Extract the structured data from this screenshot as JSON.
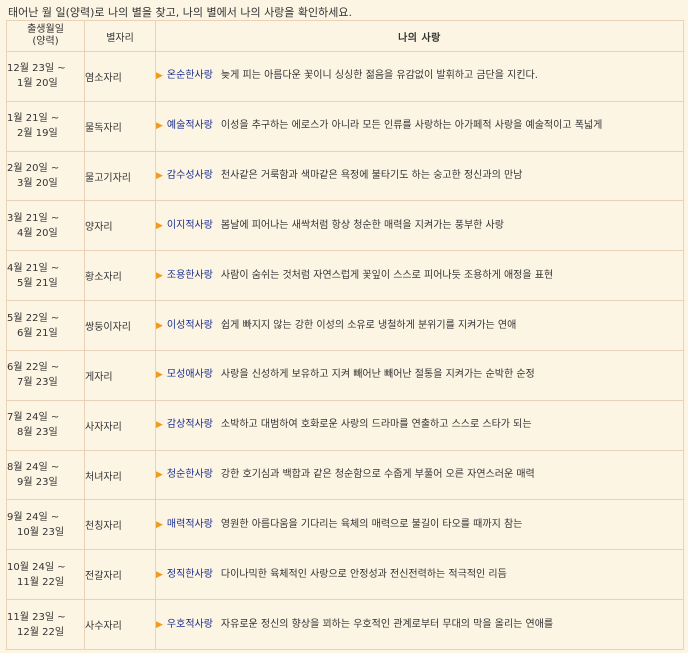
{
  "intro": "태어난 월 일(양력)로 나의 별을 찾고, 나의 별에서 나의 사랑을 확인하세요.",
  "header": {
    "date_line1": "출생월일",
    "date_line2": "(양력)",
    "sign": "별자리",
    "love": "나의 사랑"
  },
  "colors": {
    "accent_arrow": "#f39a1e",
    "love_type": "#1a2e8f",
    "border": "#e8d3b8",
    "background": "#fdf5e4"
  },
  "rows": [
    {
      "d1": "12월 23일 ~",
      "d2": "1월 20일",
      "sign": "염소자리",
      "type": "온순한사랑",
      "desc": "늦게 피는 아름다운 꽃이니 싱싱한 젊음을 유감없이 발휘하고 금단을 지킨다."
    },
    {
      "d1": "1월 21일 ~",
      "d2": "2월 19일",
      "sign": "물독자리",
      "type": "예술적사랑",
      "desc": "이성을 추구하는 에로스가 아니라 모든 인류를 사랑하는 아가페적 사랑을 예술적이고 폭넓게"
    },
    {
      "d1": "2월 20일 ~",
      "d2": "3월 20일",
      "sign": "물고기자리",
      "type": "감수성사랑",
      "desc": "천사같은 거룩함과 색마같은 욕정에 불타기도 하는 숭고한 정신과의 만남"
    },
    {
      "d1": "3월 21일 ~",
      "d2": "4월 20일",
      "sign": "양자리",
      "type": "이지적사랑",
      "desc": "봄날에 피어나는 새싹처럼 항상 청순한 매력을 지켜가는 풍부한 사랑"
    },
    {
      "d1": "4월 21일 ~",
      "d2": "5월 21일",
      "sign": "황소자리",
      "type": "조용한사랑",
      "desc": "사람이 숨쉬는 것처럼 자연스럽게 꽃잎이 스스로 피어나듯 조용하게 애정을 표현"
    },
    {
      "d1": "5월 22일 ~",
      "d2": "6월 21일",
      "sign": "쌍둥이자리",
      "type": "이성적사랑",
      "desc": "쉽게 빠지지 않는 강한 이성의 소유로 냉철하게 분위기를 지켜가는 연애"
    },
    {
      "d1": "6월 22일 ~",
      "d2": "7월 23일",
      "sign": "게자리",
      "type": "모성애사랑",
      "desc": "사랑을 신성하게 보유하고 지켜 빼어난 빼어난 절통을 지켜가는 순박한 순정"
    },
    {
      "d1": "7월 24일 ~",
      "d2": "8월 23일",
      "sign": "사자자리",
      "type": "감상적사랑",
      "desc": "소박하고 대범하여 호화로운 사랑의 드라마를 연출하고 스스로 스타가 되는"
    },
    {
      "d1": "8월 24일 ~",
      "d2": "9월 23일",
      "sign": "처녀자리",
      "type": "청순한사랑",
      "desc": "강한 호기심과 백합과 같은 청순함으로 수줍게 부풀어 오른 자연스러운 매력"
    },
    {
      "d1": "9월 24일 ~",
      "d2": "10월 23일",
      "sign": "천칭자리",
      "type": "매력적사랑",
      "desc": "영원한 아름다움을 기다리는 육체의 매력으로 불길이 타오를 때까지 참는"
    },
    {
      "d1": "10월 24일 ~",
      "d2": "11월 22일",
      "sign": "전갈자리",
      "type": "정직한사랑",
      "desc": "다이나믹한 육체적인 사랑으로 안정성과 전신전력하는 적극적인 리듬"
    },
    {
      "d1": "11월 23일 ~",
      "d2": "12월 22일",
      "sign": "사수자리",
      "type": "우호적사랑",
      "desc": "자유로운 정신의 향상을 꾀하는 우호적인 관계로부터 무대의 막을 올리는 연애를"
    }
  ]
}
